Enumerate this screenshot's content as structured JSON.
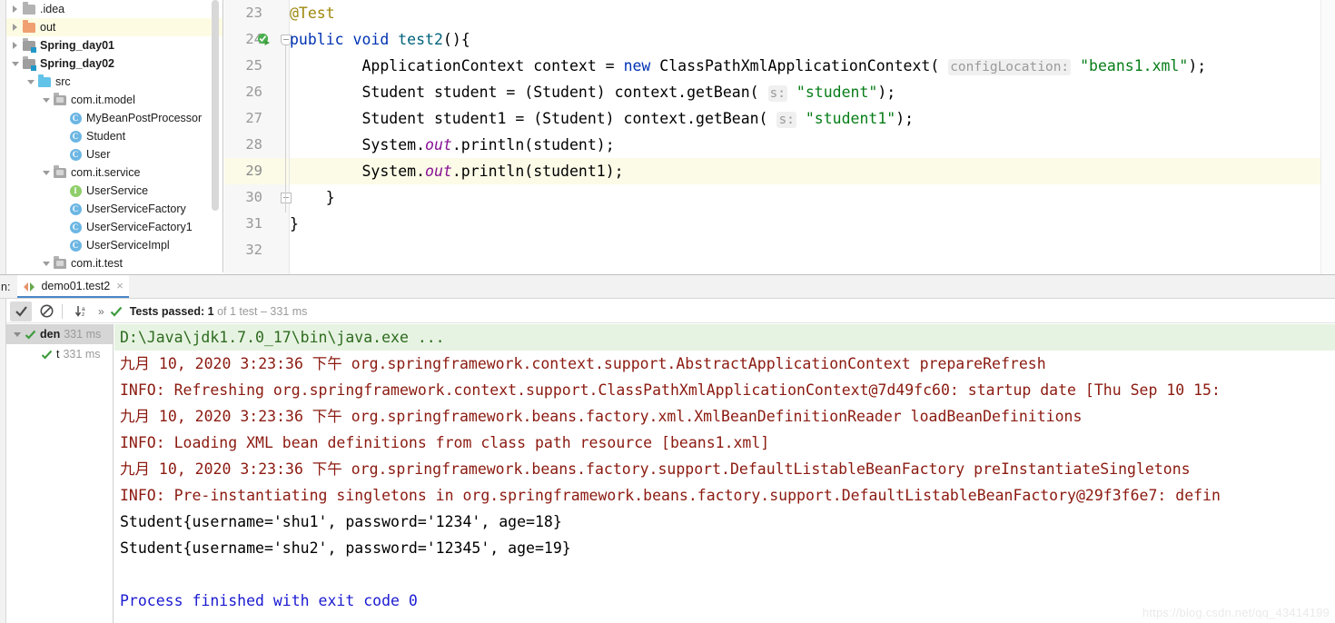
{
  "project_tree": {
    "items": [
      {
        "label": ".idea",
        "arrow": "right",
        "icon": "folder",
        "bold": false,
        "indent": 0,
        "selected": false
      },
      {
        "label": "out",
        "arrow": "right",
        "icon": "folder-orange",
        "bold": false,
        "indent": 0,
        "selected": true
      },
      {
        "label": "Spring_day01",
        "arrow": "right",
        "icon": "folder-module",
        "bold": true,
        "indent": 0,
        "selected": false
      },
      {
        "label": "Spring_day02",
        "arrow": "down",
        "icon": "folder-module",
        "bold": true,
        "indent": 0,
        "selected": false
      },
      {
        "label": "src",
        "arrow": "down",
        "icon": "folder-blue",
        "bold": false,
        "indent": 1,
        "selected": false
      },
      {
        "label": "com.it.model",
        "arrow": "down",
        "icon": "folder-package",
        "bold": false,
        "indent": 2,
        "selected": false
      },
      {
        "label": "MyBeanPostProcessor",
        "arrow": "none",
        "icon": "class",
        "bold": false,
        "indent": 3,
        "selected": false
      },
      {
        "label": "Student",
        "arrow": "none",
        "icon": "class",
        "bold": false,
        "indent": 3,
        "selected": false
      },
      {
        "label": "User",
        "arrow": "none",
        "icon": "class",
        "bold": false,
        "indent": 3,
        "selected": false
      },
      {
        "label": "com.it.service",
        "arrow": "down",
        "icon": "folder-package",
        "bold": false,
        "indent": 2,
        "selected": false
      },
      {
        "label": "UserService",
        "arrow": "none",
        "icon": "interface",
        "bold": false,
        "indent": 3,
        "selected": false
      },
      {
        "label": "UserServiceFactory",
        "arrow": "none",
        "icon": "class",
        "bold": false,
        "indent": 3,
        "selected": false
      },
      {
        "label": "UserServiceFactory1",
        "arrow": "none",
        "icon": "class",
        "bold": false,
        "indent": 3,
        "selected": false
      },
      {
        "label": "UserServiceImpl",
        "arrow": "none",
        "icon": "class",
        "bold": false,
        "indent": 3,
        "selected": false
      },
      {
        "label": "com.it.test",
        "arrow": "down",
        "icon": "folder-package",
        "bold": false,
        "indent": 2,
        "selected": false
      }
    ]
  },
  "editor": {
    "lines": [
      {
        "number": "23",
        "current": false,
        "run_icon": false
      },
      {
        "number": "24",
        "current": false,
        "run_icon": true
      },
      {
        "number": "25",
        "current": false,
        "run_icon": false
      },
      {
        "number": "26",
        "current": false,
        "run_icon": false
      },
      {
        "number": "27",
        "current": false,
        "run_icon": false
      },
      {
        "number": "28",
        "current": false,
        "run_icon": false
      },
      {
        "number": "29",
        "current": true,
        "run_icon": false
      },
      {
        "number": "30",
        "current": false,
        "run_icon": false
      },
      {
        "number": "31",
        "current": false,
        "run_icon": false
      },
      {
        "number": "32",
        "current": false,
        "run_icon": false
      }
    ],
    "code": {
      "l23_annotation": "@Test",
      "l24_kw_public": "public",
      "l24_kw_void": "void",
      "l24_method": "test2",
      "l24_tail": "(){",
      "l25_type": "        ApplicationContext context = ",
      "l25_kw_new": "new",
      "l25_ctor": " ClassPathXmlApplicationContext( ",
      "l25_hint": "configLocation:",
      "l25_str": "\"beans1.xml\"",
      "l25_tail": ");",
      "l26_pre": "        Student student = (Student) context.getBean( ",
      "l26_hint": "s:",
      "l26_str": "\"student\"",
      "l26_tail": ");",
      "l27_pre": "        Student student1 = (Student) context.getBean( ",
      "l27_hint": "s:",
      "l27_str": "\"student1\"",
      "l27_tail": ");",
      "l28_pre": "        System.",
      "l28_field": "out",
      "l28_tail": ".println(student);",
      "l29_pre": "        System.",
      "l29_field": "out",
      "l29_tail": ".println(student1);",
      "l30": "    }",
      "l31": "}"
    }
  },
  "run_panel": {
    "label": "n:",
    "tab": {
      "title": "demo01.test2",
      "close": "×"
    },
    "toolbar": {
      "rerun_failed_icon": "checkmark-icon",
      "ignore_icon": "no-entry-icon",
      "sort_alpha_icon": "sort-alphabetically-icon",
      "more_icon": "»",
      "status_prefix": "Tests passed:",
      "status_count": "1",
      "status_suffix": "of 1 test – 331 ms"
    },
    "test_tree": [
      {
        "label": "den",
        "time": "331 ms",
        "selected": true,
        "arrow": true,
        "bold": true,
        "indent": 0
      },
      {
        "label": "t",
        "time": "331 ms",
        "selected": false,
        "arrow": false,
        "bold": false,
        "indent": 1
      }
    ],
    "console": [
      {
        "text": "D:\\Java\\jdk1.7.0_17\\bin\\java.exe ...",
        "type": "cmd"
      },
      {
        "text": "九月 10, 2020 3:23:36 下午 org.springframework.context.support.AbstractApplicationContext prepareRefresh",
        "type": "err"
      },
      {
        "text": "INFO: Refreshing org.springframework.context.support.ClassPathXmlApplicationContext@7d49fc60: startup date [Thu Sep 10 15:",
        "type": "err"
      },
      {
        "text": "九月 10, 2020 3:23:36 下午 org.springframework.beans.factory.xml.XmlBeanDefinitionReader loadBeanDefinitions",
        "type": "err"
      },
      {
        "text": "INFO: Loading XML bean definitions from class path resource [beans1.xml]",
        "type": "err"
      },
      {
        "text": "九月 10, 2020 3:23:36 下午 org.springframework.beans.factory.support.DefaultListableBeanFactory preInstantiateSingletons",
        "type": "err"
      },
      {
        "text": "INFO: Pre-instantiating singletons in org.springframework.beans.factory.support.DefaultListableBeanFactory@29f3f6e7: defin",
        "type": "err"
      },
      {
        "text": "Student{username='shu1', password='1234', age=18}",
        "type": "out"
      },
      {
        "text": "Student{username='shu2', password='12345', age=19}",
        "type": "out"
      },
      {
        "text": "",
        "type": "blank"
      },
      {
        "text": "Process finished with exit code 0",
        "type": "done"
      }
    ]
  },
  "watermark": "https://blog.csdn.net/qq_43414199"
}
